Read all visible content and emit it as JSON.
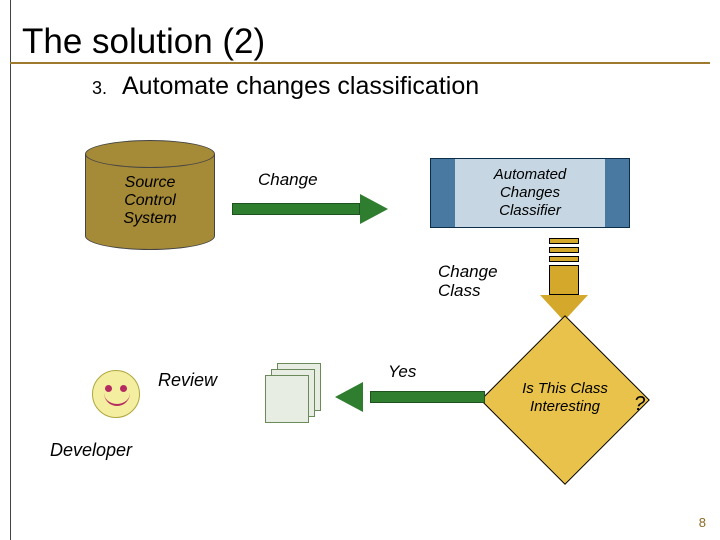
{
  "slide": {
    "title": "The solution (2)",
    "list_number": "3.",
    "list_text": "Automate changes classification",
    "page_number": "8"
  },
  "nodes": {
    "source_control": "Source\nControl\nSystem",
    "classifier": "Automated\nChanges\nClassifier",
    "decision": "Is This Class\nInteresting",
    "decision_mark": "?",
    "developer": "Developer"
  },
  "edges": {
    "change": "Change",
    "change_class": "Change\nClass",
    "yes": "Yes",
    "review": "Review"
  },
  "colors": {
    "accent_border": "#9e7a2f",
    "cylinder": "#a58a37",
    "arrow_green": "#2f7d2f",
    "arrow_gold": "#d4a82a",
    "diamond": "#e8c24a",
    "classifier_dark": "#4979a0",
    "classifier_light": "#c6d6e2"
  }
}
